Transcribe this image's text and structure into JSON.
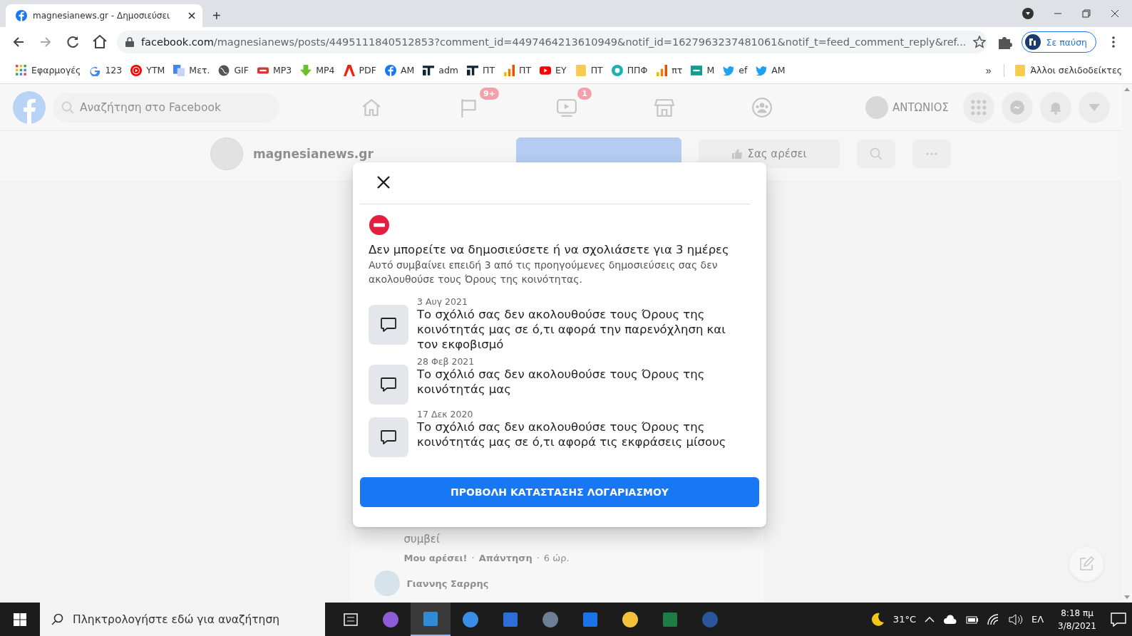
{
  "browser": {
    "tabs": [
      {
        "title": "magnesianews.gr - Δημοσιεύσει",
        "selected": true
      }
    ],
    "new_tab": "+",
    "url": {
      "domain": "facebook.com",
      "path": "/magnesianews/posts/4495111840512853?comment_id=4497464213610949&notif_id=1627963237481061&notif_t=feed_comment_reply&ref..."
    },
    "profile_button": "Σε παύση",
    "bookmarks": [
      {
        "label": "Εφαρμογές",
        "kind": "apps"
      },
      {
        "label": "123",
        "kind": "google"
      },
      {
        "label": "YTM",
        "kind": "ytm"
      },
      {
        "label": "Μετ.",
        "kind": "translate"
      },
      {
        "label": "GIF",
        "kind": "globe"
      },
      {
        "label": "MP3",
        "kind": "mp3"
      },
      {
        "label": "MP4",
        "kind": "download"
      },
      {
        "label": "PDF",
        "kind": "pdf"
      },
      {
        "label": "AM",
        "kind": "facebook"
      },
      {
        "label": "adm",
        "kind": "tt"
      },
      {
        "label": "ΠΤ",
        "kind": "tt"
      },
      {
        "label": "ΠΤ",
        "kind": "chart"
      },
      {
        "label": "ΕΥ",
        "kind": "youtube"
      },
      {
        "label": "ΠΤ",
        "kind": "folder"
      },
      {
        "label": "ΠΠΦ",
        "kind": "ppf"
      },
      {
        "label": "πτ",
        "kind": "chart"
      },
      {
        "label": "M",
        "kind": "sheet"
      },
      {
        "label": "ef",
        "kind": "twitter"
      },
      {
        "label": "AM",
        "kind": "twitter"
      }
    ],
    "more_bookmarks": "»",
    "other_bookmarks": "Άλλοι σελιδοδείκτες"
  },
  "facebook": {
    "search": {
      "placeholder": "Αναζήτηση στο Facebook"
    },
    "nav": [
      {
        "kind": "home"
      },
      {
        "kind": "flag",
        "badge": "9+"
      },
      {
        "kind": "video",
        "badge": "1"
      },
      {
        "kind": "store"
      },
      {
        "kind": "groups"
      }
    ],
    "profile_name": "ΑΝΤΩΝΙΟΣ",
    "page_name": "magnesianews.gr",
    "like_button": "Σας αρέσει",
    "comment": {
      "text": "συμβεί",
      "actions": [
        "Μου αρέσει!",
        "Απάντηση",
        "6 ώρ."
      ],
      "separator": "·",
      "next_author": "Γιαννης Σαρρης"
    }
  },
  "modal": {
    "title": "Δεν μπορείτε να δημοσιεύσετε ή να σχολιάσετε για 3 ημέρες",
    "body": "Αυτό συμβαίνει επειδή 3 από τις προηγούμενες δημοσιεύσεις σας δεν ακολουθούσε τους Όρους της κοινότητας.",
    "items": [
      {
        "date": "3 Αυγ 2021",
        "text": "Το σχόλιό σας δεν ακολουθούσε τους Όρους της κοινότητάς μας σε ό,τι αφορά την παρενόχληση και τον εκφοβισμό"
      },
      {
        "date": "28 Φεβ 2021",
        "text": "Το σχόλιό σας δεν ακολουθούσε τους Όρους της κοινότητάς μας"
      },
      {
        "date": "17 Δεκ 2020",
        "text": "Το σχόλιό σας δεν ακολουθούσε τους Όρους της κοινότητάς μας σε ό,τι αφορά τις εκφράσεις μίσους"
      }
    ],
    "button": "ΠΡΟΒΟΛΗ ΚΑΤΑΣΤΑΣΗΣ ΛΟΓΑΡΙΑΣΜΟΥ"
  },
  "taskbar": {
    "search": {
      "placeholder": "Πληκτρολογήστε εδώ για αναζήτηση"
    },
    "temperature": "31°C",
    "language": "ΕΛ",
    "time": "8:18 πμ",
    "date": "3/8/2021"
  }
}
